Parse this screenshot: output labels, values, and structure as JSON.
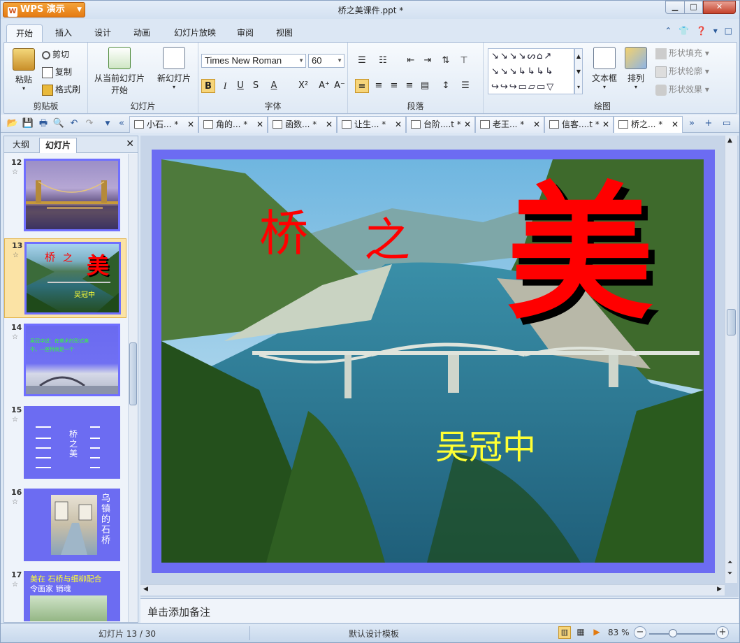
{
  "app": {
    "name": "WPS 演示",
    "window_title": "桥之美课件.ppt *"
  },
  "menu_tabs": [
    "开始",
    "插入",
    "设计",
    "动画",
    "幻灯片放映",
    "审阅",
    "视图"
  ],
  "ribbon": {
    "clipboard": {
      "paste": "粘贴",
      "cut": "剪切",
      "copy": "复制",
      "format_painter": "格式刷",
      "label": "剪贴板"
    },
    "slides": {
      "from_current": "从当前幻灯片",
      "start": "开始",
      "new_slide": "新幻灯片",
      "label": "幻灯片"
    },
    "font": {
      "font_name": "Times New Roman",
      "font_size": "60",
      "label": "字体"
    },
    "paragraph": {
      "label": "段落"
    },
    "drawing": {
      "textbox": "文本框",
      "arrange": "排列",
      "shape_fill": "形状填充",
      "shape_outline": "形状轮廓",
      "shape_effect": "形状效果",
      "label": "绘图"
    }
  },
  "doc_tabs": [
    {
      "label": "小石... *",
      "active": false
    },
    {
      "label": "角的... *",
      "active": false
    },
    {
      "label": "函数... *",
      "active": false
    },
    {
      "label": "让生... *",
      "active": false
    },
    {
      "label": "台阶....t *",
      "active": false
    },
    {
      "label": "老王... *",
      "active": false
    },
    {
      "label": "信客....t *",
      "active": false
    },
    {
      "label": "桥之... *",
      "active": true
    }
  ],
  "sidebar": {
    "tab_outline": "大纲",
    "tab_slides": "幻灯片",
    "thumbnails": [
      {
        "num": "12",
        "selected": false
      },
      {
        "num": "13",
        "selected": true
      },
      {
        "num": "14",
        "selected": false
      },
      {
        "num": "15",
        "selected": false
      },
      {
        "num": "16",
        "selected": false
      },
      {
        "num": "17",
        "selected": false
      }
    ]
  },
  "slide": {
    "title_part1": "桥",
    "title_part2": "之",
    "title_big": "美",
    "author": "吴冠中",
    "border_color": "#6c6cf2",
    "title_color": "#ff0000",
    "author_color": "#ffff33"
  },
  "thumbs_text": {
    "t13_a": "桥",
    "t13_b": "之",
    "t13_c": "美",
    "t13_d": "吴冠中",
    "t14_l1": "吴冠中说：在美术的形式美",
    "t14_l2": "中，一座桥就是一个",
    "t15_title": "桥之美",
    "t16_side": "乌镇的石桥",
    "t17_l1": "美在 石桥与细柳配合",
    "t17_l2": "令画家 销魂"
  },
  "notes": {
    "placeholder": "单击添加备注"
  },
  "status": {
    "slide_counter": "幻灯片 13 / 30",
    "template": "默认设计模板",
    "zoom": "83 %"
  }
}
